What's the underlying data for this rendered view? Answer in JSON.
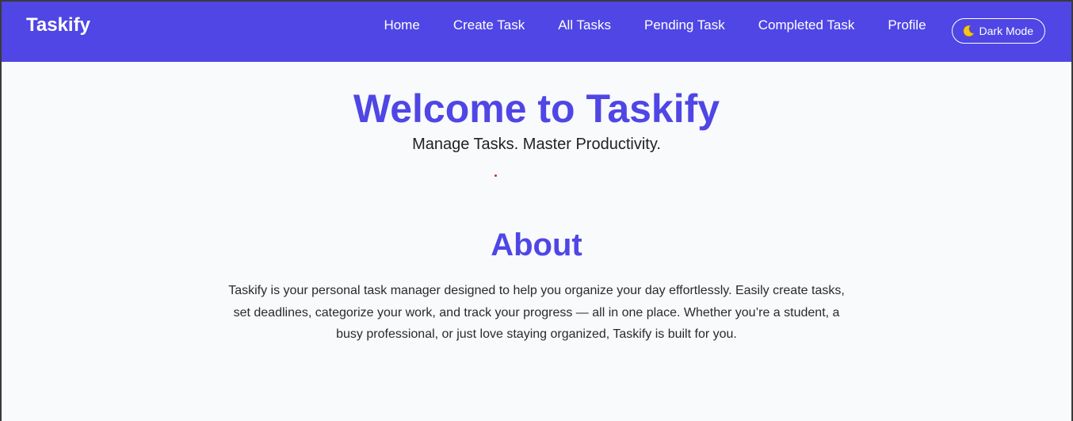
{
  "brand": "Taskify",
  "nav": {
    "links": [
      "Home",
      "Create Task",
      "All Tasks",
      "Pending Task",
      "Completed Task",
      "Profile"
    ],
    "dark_mode_label": "Dark Mode",
    "dark_mode_icon": "moon-icon"
  },
  "hero": {
    "title": "Welcome to Taskify",
    "subtitle": "Manage Tasks. Master Productivity."
  },
  "about": {
    "title": "About",
    "text": "Taskify is your personal task manager designed to help you organize your day effortlessly. Easily create tasks, set deadlines, categorize your work, and track your progress — all in one place. Whether you’re a student, a busy professional, or just love staying organized, Taskify is built for you."
  },
  "colors": {
    "primary": "#4f46e5",
    "background": "#f8fafc",
    "text": "#222222"
  }
}
